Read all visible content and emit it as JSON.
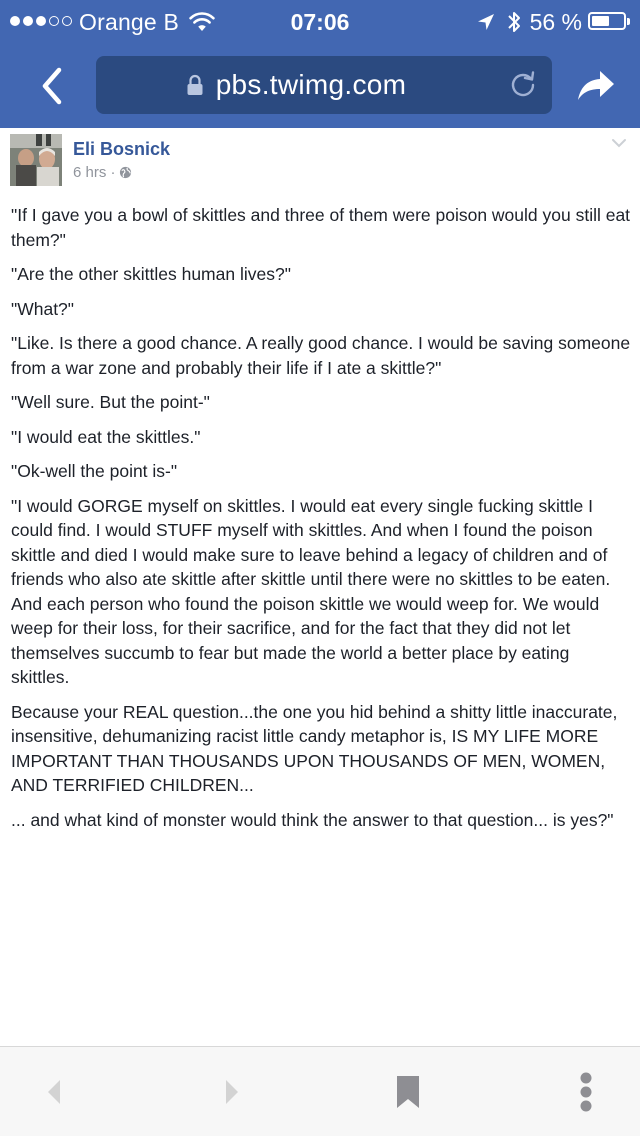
{
  "status_bar": {
    "signal_dots_filled": 3,
    "signal_dots_total": 5,
    "carrier": "Orange B",
    "time": "07:06",
    "battery_percent": "56 %",
    "battery_level": 0.56
  },
  "browser": {
    "url": "pbs.twimg.com",
    "header_color": "#4267b2"
  },
  "post": {
    "author": "Eli Bosnick",
    "time": "6 hrs ·",
    "paragraphs": [
      "\"If I gave you a bowl of skittles and three of them were poison would you still eat them?\"",
      "\"Are the other skittles human lives?\"",
      "\"What?\"",
      "\"Like. Is there a good chance. A really good chance. I would be saving someone from a war zone and probably their life if I ate a skittle?\"",
      "\"Well sure. But the point-\"",
      "\"I would eat the skittles.\"",
      "\"Ok-well the point is-\"",
      "\"I would GORGE myself on skittles. I would eat every single fucking skittle I could find. I would STUFF myself with skittles. And when I found the poison skittle and died I would make sure to leave behind a legacy of children and of friends who also ate skittle after skittle until there were no skittles to be eaten. And each person who found the poison skittle we would weep for. We would weep for their loss, for their sacrifice, and for the fact that they did not let themselves succumb to fear but made the world a better place by eating skittles.",
      "Because your REAL question...the one you hid behind a shitty little inaccurate, insensitive, dehumanizing racist little candy metaphor is, IS MY LIFE MORE IMPORTANT THAN THOUSANDS UPON THOUSANDS OF MEN, WOMEN, AND TERRIFIED CHILDREN...",
      "... and what kind of monster would think the answer to that question... is yes?\""
    ]
  },
  "toolbar": {
    "icons": [
      "back-arrow-icon",
      "forward-arrow-icon",
      "bookmark-icon",
      "more-options-icon"
    ]
  }
}
